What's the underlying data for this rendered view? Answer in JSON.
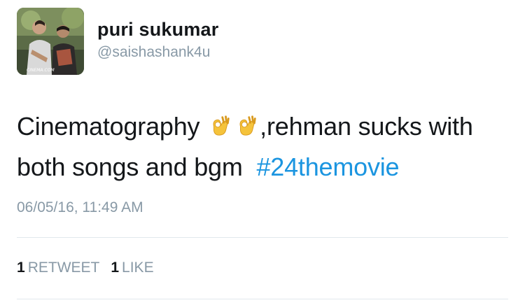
{
  "user": {
    "display_name": "puri sukumar",
    "handle": "@saishashank4u",
    "avatar_watermark": "CINEMA.COM"
  },
  "tweet": {
    "text_part1": "Cinematography ",
    "emoji_name": "ok-hand-icon",
    "text_part2": ",rehman sucks with both songs and bgm ",
    "hashtag": "#24themovie",
    "timestamp": "06/05/16, 11:49 AM"
  },
  "stats": {
    "retweets_count": "1",
    "retweets_label": "RETWEET",
    "likes_count": "1",
    "likes_label": "LIKE"
  },
  "colors": {
    "link": "#1b95e0",
    "secondary_text": "#8899a6",
    "primary_text": "#14171a",
    "divider": "#e1e8ed",
    "emoji": "#f5c33b"
  }
}
